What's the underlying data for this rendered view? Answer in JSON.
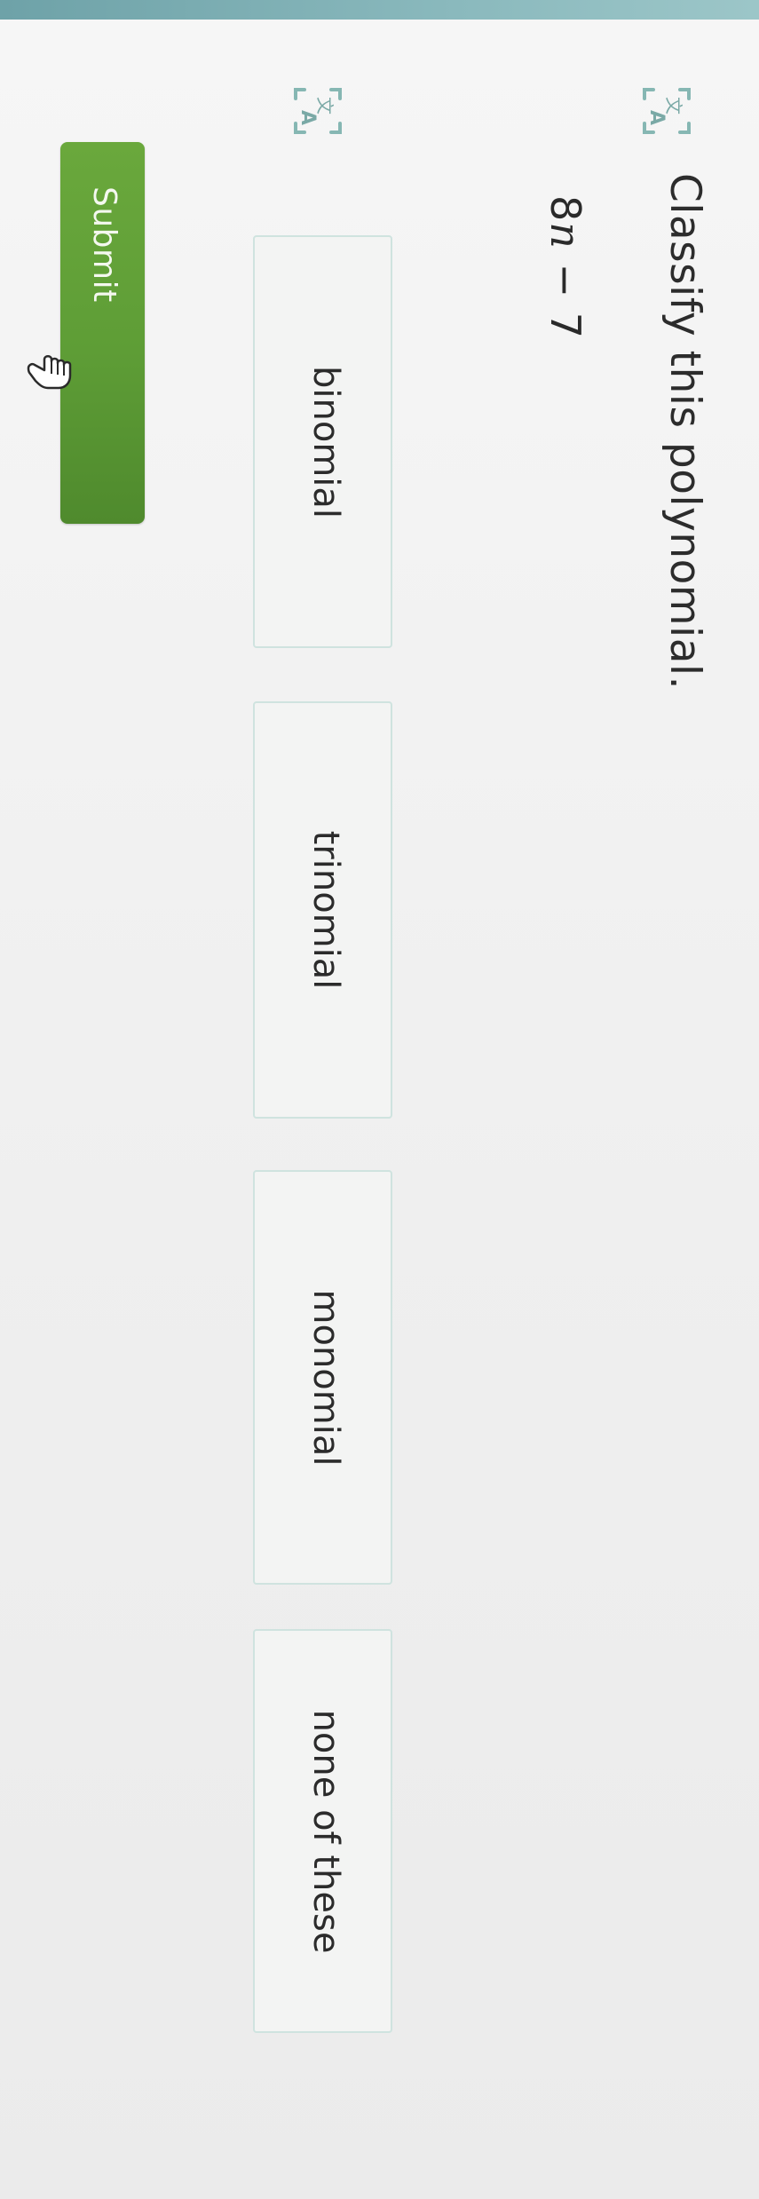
{
  "question": {
    "prompt": "Classify this polynomial.",
    "expression": {
      "coefficient": "8",
      "variable": "n",
      "operator": "−",
      "constant": "7"
    }
  },
  "options": [
    {
      "label": "binomial"
    },
    {
      "label": "trinomial"
    },
    {
      "label": "monomial"
    },
    {
      "label": "none of these"
    }
  ],
  "submit": {
    "label": "Submit"
  },
  "colors": {
    "accent_green": "#5e9d36",
    "option_border": "#cfe3df",
    "icon_teal": "#7fb3b0",
    "header_strip": "#7fb0b5"
  },
  "icons": {
    "translate": "translate-icon",
    "cursor": "hand-pointer-icon"
  }
}
